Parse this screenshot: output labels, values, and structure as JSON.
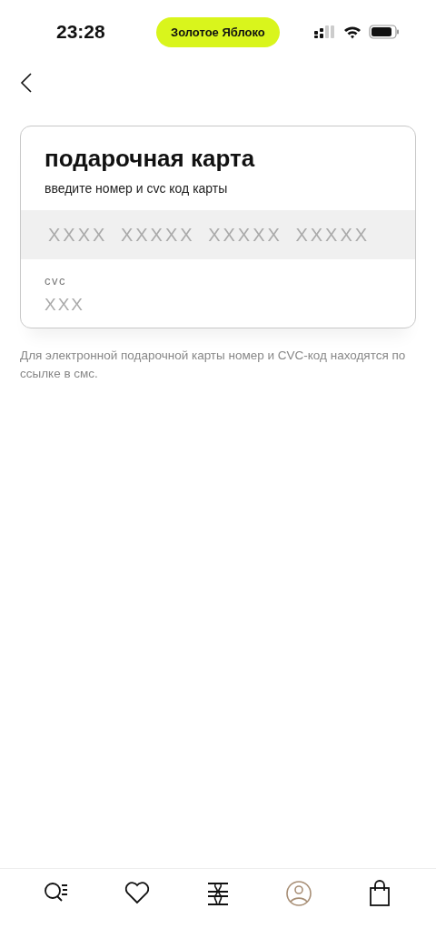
{
  "status_bar": {
    "time": "23:28",
    "pill": "Золотое Яблоко"
  },
  "card": {
    "title": "подарочная карта",
    "subtitle": "введите номер и cvc код карты",
    "number_field": {
      "placeholder": "XXXX XXXXX XXXXX XXXXX"
    },
    "cvc_field": {
      "label": "cvc",
      "placeholder": "XXX"
    }
  },
  "note": "Для электронной подарочной карты номер и CVC-код находятся по ссылке в смс.",
  "tab_bar": [
    {
      "kind": "search",
      "selected": false
    },
    {
      "kind": "favorites",
      "selected": false
    },
    {
      "kind": "brand",
      "selected": false
    },
    {
      "kind": "profile",
      "selected": true
    },
    {
      "kind": "bag",
      "selected": false
    }
  ]
}
